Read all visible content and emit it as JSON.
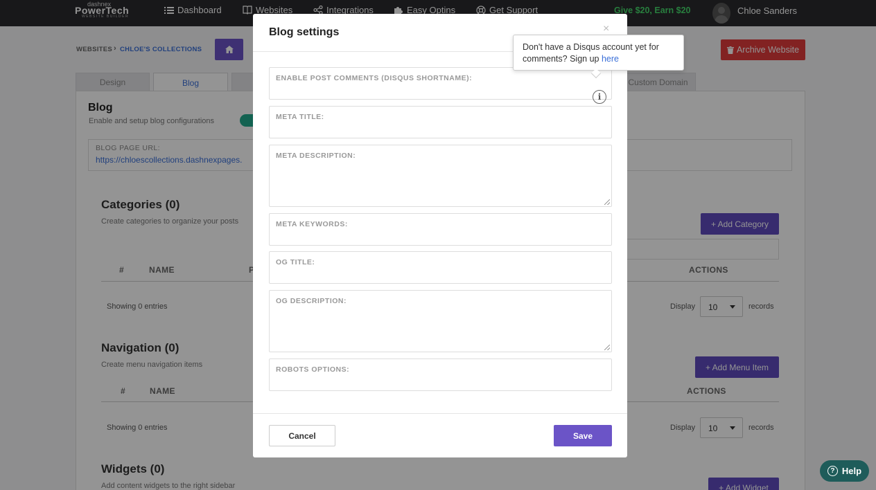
{
  "brand": {
    "small": "dashnex",
    "name": "PowerTech",
    "sub": "WEBSITE BUILDER"
  },
  "nav": {
    "items": [
      {
        "label": "Dashboard",
        "icon": "list-icon"
      },
      {
        "label": "Websites",
        "icon": "book-icon"
      },
      {
        "label": "Integrations",
        "icon": "share-icon"
      },
      {
        "label": "Easy Optins",
        "icon": "puzzle-icon"
      },
      {
        "label": "Get Support",
        "icon": "lifebuoy-icon"
      }
    ],
    "promo": "Give $20, Earn $20",
    "user": "Chloe Sanders"
  },
  "breadcrumb": {
    "root": "WEBSITES",
    "sep": "›",
    "current": "CHLOE'S COLLECTIONS"
  },
  "archive_label": "Archive Website",
  "tabs": [
    "Design",
    "Blog",
    "Custom Domain"
  ],
  "blog": {
    "title": "Blog",
    "subtitle": "Enable and setup blog configurations",
    "url_label": "BLOG PAGE URL:",
    "url_value": "https://chloescollections.dashnexpages."
  },
  "categories": {
    "title": "Categories (0)",
    "subtitle": "Create categories to organize your posts",
    "add_label": "+ Add Category",
    "col_hash": "#",
    "col_name": "NAME",
    "col_partial": "P",
    "col_actions": "ACTIONS",
    "showing": "Showing 0 entries",
    "display": "Display",
    "display_value": "10",
    "records": "records"
  },
  "navigation": {
    "title": "Navigation (0)",
    "subtitle": "Create menu navigation items",
    "add_label": "+ Add Menu Item",
    "col_hash": "#",
    "col_name": "NAME",
    "col_actions": "ACTIONS",
    "showing": "Showing 0 entries",
    "display": "Display",
    "display_value": "10",
    "records": "records"
  },
  "widgets": {
    "title": "Widgets (0)",
    "subtitle": "Add content widgets to the right sidebar",
    "add_label": "+ Add Widget"
  },
  "modal": {
    "title": "Blog settings",
    "close": "×",
    "fields": {
      "comments": "ENABLE POST COMMENTS (DISQUS SHORTNAME):",
      "meta_title": "META TITLE:",
      "meta_description": "META DESCRIPTION:",
      "meta_keywords": "META KEYWORDS:",
      "og_title": "OG TITLE:",
      "og_description": "OG DESCRIPTION:",
      "robots": "ROBOTS OPTIONS:"
    },
    "cancel": "Cancel",
    "save": "Save"
  },
  "tooltip": {
    "text": "Don't have a Disqus account yet for comments? Sign up",
    "link": "here"
  },
  "help": "Help",
  "colors": {
    "accent": "#6b54c7",
    "danger": "#e03b3b",
    "promo": "#45d96b",
    "toggle": "#22a98c",
    "help": "#1e5c5a"
  }
}
